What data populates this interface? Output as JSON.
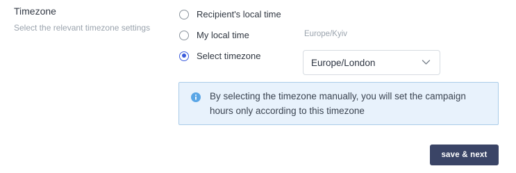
{
  "section": {
    "title": "Timezone",
    "subtitle": "Select the relevant timezone settings"
  },
  "options": [
    {
      "label": "Recipient's local time",
      "checked": false
    },
    {
      "label": "My local time",
      "checked": false,
      "hint": "Europe/Kyiv"
    },
    {
      "label": "Select timezone",
      "checked": true
    }
  ],
  "timezone_select": {
    "value": "Europe/London",
    "icon": "chevron-down-icon"
  },
  "info": {
    "icon": "info-icon",
    "text": "By selecting the timezone manually, you will set the campaign hours only according to this timezone"
  },
  "actions": {
    "save_next_label": "save & next"
  },
  "colors": {
    "accent": "#3b5bdb",
    "button_bg": "#3a4466",
    "info_bg": "#e8f2fc",
    "info_border": "#a9cbe8",
    "info_icon": "#5aa6e6"
  }
}
